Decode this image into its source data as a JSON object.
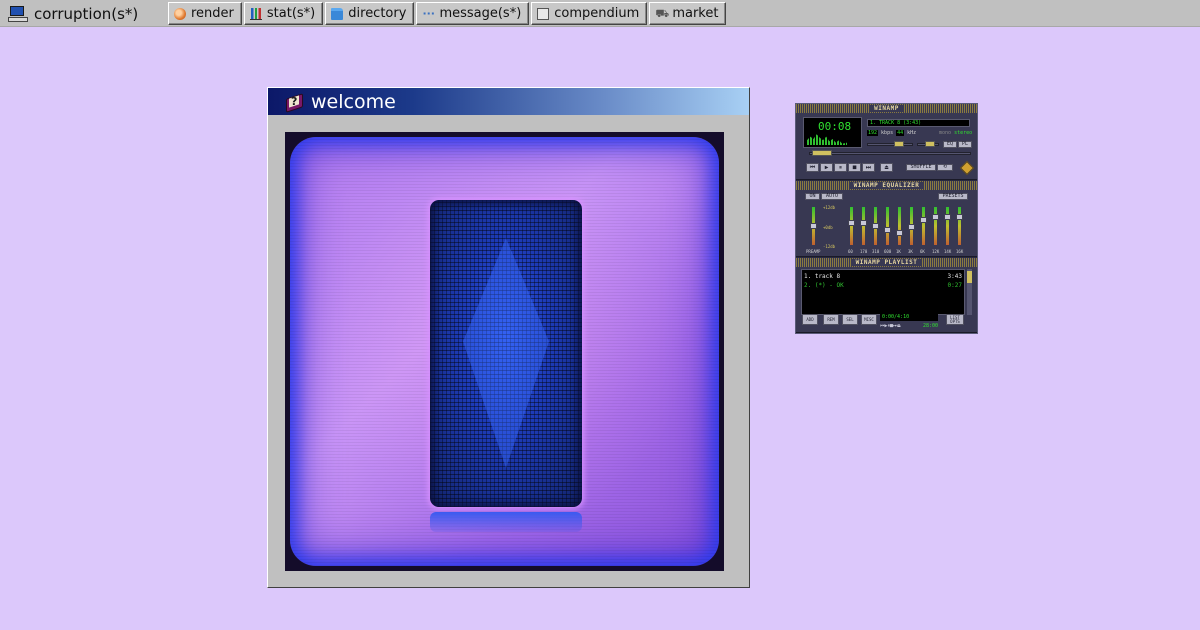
{
  "taskbar": {
    "brand": "corruption(s*)",
    "tabs": [
      {
        "id": "render",
        "label": "render",
        "icon": "render-icon"
      },
      {
        "id": "stat",
        "label": "stat(s*)",
        "icon": "chart-icon"
      },
      {
        "id": "directory",
        "label": "directory",
        "icon": "folder-icon"
      },
      {
        "id": "message",
        "label": "message(s*)",
        "icon": "speech-bubble-icon"
      },
      {
        "id": "compendium",
        "label": "compendium",
        "icon": "document-icon"
      },
      {
        "id": "market",
        "label": "market",
        "icon": "cart-icon"
      }
    ]
  },
  "window": {
    "title": "welcome",
    "icon": "help-book-icon"
  },
  "winamp": {
    "main_title": "WINAMP",
    "time": "00:08",
    "track_display": "1. TRACK 8 (3:43)",
    "kbps": "192",
    "kbps_label": "kbps",
    "khz": "44",
    "khz_label": "kHz",
    "mono_label": "mono",
    "stereo_label": "stereo",
    "eq_title": "WINAMP EQUALIZER",
    "eq_on": "ON",
    "eq_auto": "AUTO",
    "eq_presets": "PRESETS",
    "eq_plus": "+12db",
    "eq_zero": "+0db",
    "eq_minus": "-12db",
    "eq_preamp": "PREAMP",
    "eq_bands": [
      "60",
      "170",
      "310",
      "600",
      "1K",
      "3K",
      "6K",
      "12K",
      "14K",
      "16K"
    ],
    "pl_title": "WINAMP PLAYLIST",
    "playlist": [
      {
        "title": "1. track 8",
        "duration": "3:43"
      },
      {
        "title": "2. (*) - OK",
        "duration": "0:27"
      }
    ],
    "pl_buttons": [
      "ADD",
      "REM",
      "SEL",
      "MISC"
    ],
    "pl_time": "0:00/4:10",
    "pl_clock": "28:00",
    "pl_list": "LIST OPTS",
    "shuffle": "SHUFFLE"
  }
}
